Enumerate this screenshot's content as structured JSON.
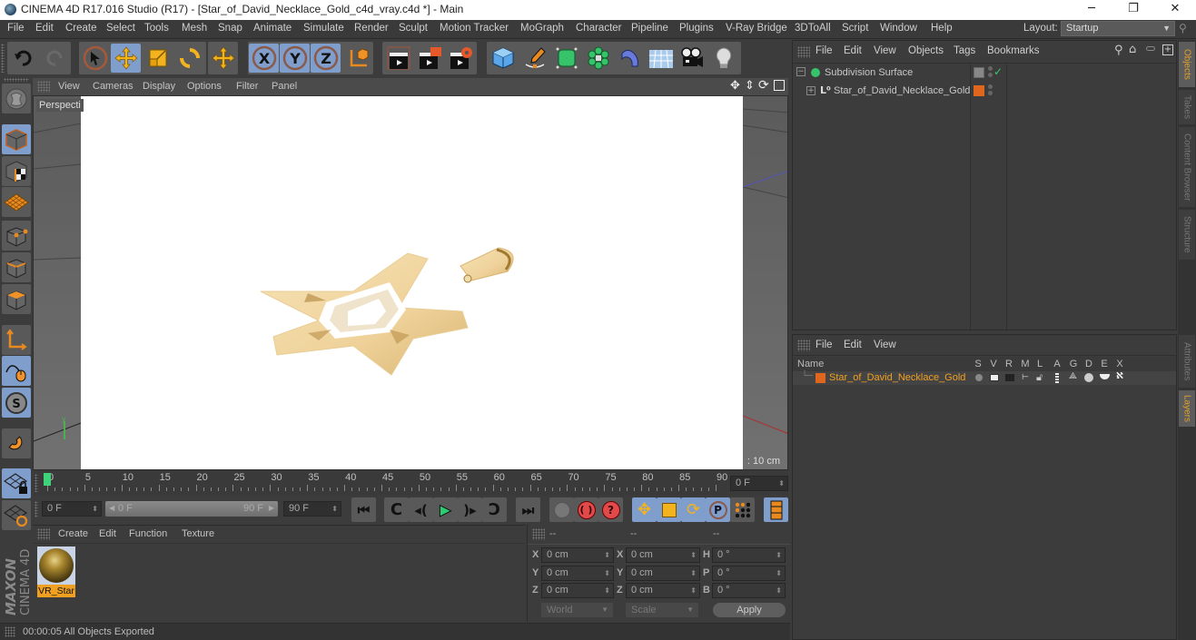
{
  "window": {
    "title": "CINEMA 4D R17.016 Studio (R17) - [Star_of_David_Necklace_Gold_c4d_vray.c4d *] - Main",
    "controls": {
      "minimize": "─",
      "maximize": "❐",
      "close": "✕"
    }
  },
  "menubar": {
    "items": [
      "File",
      "Edit",
      "Create",
      "Select",
      "Tools",
      "Mesh",
      "Snap",
      "Animate",
      "Simulate",
      "Render",
      "Sculpt",
      "Motion Tracker",
      "MoGraph",
      "Character",
      "Pipeline",
      "Plugins",
      "V-Ray Bridge",
      "3DToAll",
      "Script",
      "Window",
      "Help"
    ],
    "layout_label": "Layout:",
    "layout_value": "Startup"
  },
  "toolbar": {
    "groups": [
      {
        "items": [
          "undo-icon",
          "redo-icon"
        ]
      },
      {
        "items": [
          "live-selection-icon",
          "move-icon",
          "scale-icon",
          "rotate-icon"
        ]
      },
      {
        "items": [
          "recent-tools-icon"
        ]
      },
      {
        "items": [
          "lock-x-axis-icon",
          "lock-y-axis-icon",
          "lock-z-axis-icon",
          "world-coordinates-icon"
        ]
      },
      {
        "items": [
          "render-view-icon",
          "render-to-picture-viewer-icon",
          "render-settings-icon"
        ]
      },
      {
        "items": [
          "cube-primitive-icon",
          "pen-spline-icon",
          "subdivision-surface-icon",
          "mograph-cloner-icon",
          "deformer-bend-icon",
          "floor-icon",
          "camera-icon",
          "light-icon"
        ]
      }
    ],
    "axis_labels": {
      "x": "X",
      "y": "Y",
      "z": "Z"
    }
  },
  "viewport": {
    "menu": [
      "View",
      "Cameras",
      "Display",
      "Options",
      "Filter",
      "Panel"
    ],
    "label": "Perspecti",
    "grid_spacing": ": 10 cm",
    "nav_icons": [
      "move-view-icon",
      "zoom-view-icon",
      "rotate-view-icon",
      "toggle-layout-icon"
    ],
    "axis_label": "y"
  },
  "left_tools": [
    "make-editable-icon",
    "model-mode-icon",
    "texture-mode-icon",
    "workplane-mode-icon",
    "points-mode-icon",
    "edges-mode-icon",
    "polygons-mode-icon",
    "axis-mode-icon",
    "tweak-mode-icon",
    "solo-mode-icon",
    "snap-icon",
    "workplane-lock-icon",
    "workplane-align-icon"
  ],
  "timeline": {
    "ticks": [
      0,
      5,
      10,
      15,
      20,
      25,
      30,
      35,
      40,
      45,
      50,
      55,
      60,
      65,
      70,
      75,
      80,
      85,
      90
    ],
    "current_frame": "0 F",
    "playhead": 0,
    "min": 0,
    "max": 90
  },
  "controls": {
    "start_field": "0 F",
    "range_start": "0 F",
    "range_end": "90 F",
    "end_field": "90 F",
    "buttons": [
      "go-to-start-icon",
      "previous-key-icon",
      "play-backwards-icon",
      "play-forwards-icon",
      "next-key-icon",
      "go-to-end-icon",
      "record-icon",
      "autokey-icon",
      "keyframe-selection-icon",
      "position-key-icon",
      "scale-key-icon",
      "rotation-key-icon",
      "parameter-key-icon",
      "pla-key-icon",
      "timeline-icon"
    ],
    "param_label": "P"
  },
  "material_manager": {
    "menu": [
      "Create",
      "Edit",
      "Function",
      "Texture"
    ],
    "materials": [
      {
        "name": "VR_Star"
      }
    ]
  },
  "coordinates": {
    "headers": [
      "--",
      "--",
      "--"
    ],
    "rows": [
      {
        "pos_label": "X",
        "pos": "0 cm",
        "size_label": "X",
        "size": "0 cm",
        "rot_label": "H",
        "rot": "0 °"
      },
      {
        "pos_label": "Y",
        "pos": "0 cm",
        "size_label": "Y",
        "size": "0 cm",
        "rot_label": "P",
        "rot": "0 °"
      },
      {
        "pos_label": "Z",
        "pos": "0 cm",
        "size_label": "Z",
        "size": "0 cm",
        "rot_label": "B",
        "rot": "0 °"
      }
    ],
    "mode_select": "World",
    "size_select": "Scale",
    "apply_label": "Apply"
  },
  "status": {
    "text": "00:00:05 All Objects Exported"
  },
  "objects_panel": {
    "menu": [
      "File",
      "Edit",
      "View",
      "Objects",
      "Tags",
      "Bookmarks"
    ],
    "tree": [
      {
        "name": "Subdivision Surface",
        "indent": 0,
        "icon": "subdivision-surface-icon",
        "color": "#36c36a",
        "enabled": true
      },
      {
        "name": "Star_of_David_Necklace_Gold",
        "indent": 1,
        "icon": "null-object-icon",
        "color": "#e0661e"
      }
    ]
  },
  "layers_panel": {
    "menu": [
      "File",
      "Edit",
      "View"
    ],
    "headers": {
      "name": "Name",
      "columns": [
        "S",
        "V",
        "R",
        "M",
        "L",
        "A",
        "G",
        "D",
        "E",
        "X"
      ]
    },
    "layers": [
      {
        "name": "Star_of_David_Necklace_Gold",
        "color": "#e0661e"
      }
    ]
  },
  "side_tabs": {
    "top": [
      "Objects",
      "Takes",
      "Content Browser",
      "Structure"
    ],
    "bottom": [
      "Attributes",
      "Layers"
    ],
    "active": [
      "Objects",
      "Layers"
    ]
  },
  "branding": {
    "maxon": "MAXON",
    "cinema": "CINEMA 4D"
  },
  "colors": {
    "accent": "#e0a030",
    "selected_tool": "#7f9ecb",
    "layer_color": "#e0661e",
    "subdiv_green": "#36c36a"
  }
}
